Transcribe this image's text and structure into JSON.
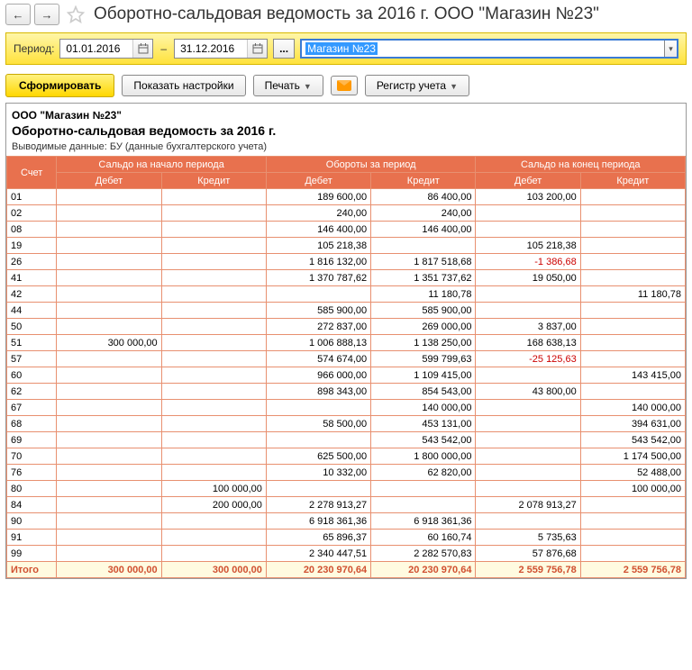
{
  "page_title": "Оборотно-сальдовая ведомость за 2016 г. ООО \"Магазин №23\"",
  "period": {
    "label": "Период:",
    "from": "01.01.2016",
    "to": "31.12.2016",
    "dash": "–",
    "dots": "..."
  },
  "org": {
    "value": "Магазин №23"
  },
  "buttons": {
    "form": "Сформировать",
    "show_settings": "Показать настройки",
    "print": "Печать",
    "register": "Регистр учета"
  },
  "report": {
    "company": "ООО \"Магазин №23\"",
    "title": "Оборотно-сальдовая ведомость за 2016 г.",
    "sub": "Выводимые данные:  БУ (данные бухгалтерского учета)",
    "hdr": {
      "account": "Счет",
      "open": "Сальдо на начало периода",
      "turnover": "Обороты за период",
      "close": "Сальдо на конец периода",
      "debit": "Дебет",
      "credit": "Кредит"
    },
    "rows": [
      {
        "acc": "01",
        "od": "",
        "oc": "",
        "td": "189 600,00",
        "tc": "86 400,00",
        "cd": "103 200,00",
        "cc": ""
      },
      {
        "acc": "02",
        "od": "",
        "oc": "",
        "td": "240,00",
        "tc": "240,00",
        "cd": "",
        "cc": ""
      },
      {
        "acc": "08",
        "od": "",
        "oc": "",
        "td": "146 400,00",
        "tc": "146 400,00",
        "cd": "",
        "cc": ""
      },
      {
        "acc": "19",
        "od": "",
        "oc": "",
        "td": "105 218,38",
        "tc": "",
        "cd": "105 218,38",
        "cc": ""
      },
      {
        "acc": "26",
        "od": "",
        "oc": "",
        "td": "1 816 132,00",
        "tc": "1 817 518,68",
        "cd": "-1 386,68",
        "cc": "",
        "neg_cd": true
      },
      {
        "acc": "41",
        "od": "",
        "oc": "",
        "td": "1 370 787,62",
        "tc": "1 351 737,62",
        "cd": "19 050,00",
        "cc": ""
      },
      {
        "acc": "42",
        "od": "",
        "oc": "",
        "td": "",
        "tc": "11 180,78",
        "cd": "",
        "cc": "11 180,78"
      },
      {
        "acc": "44",
        "od": "",
        "oc": "",
        "td": "585 900,00",
        "tc": "585 900,00",
        "cd": "",
        "cc": ""
      },
      {
        "acc": "50",
        "od": "",
        "oc": "",
        "td": "272 837,00",
        "tc": "269 000,00",
        "cd": "3 837,00",
        "cc": ""
      },
      {
        "acc": "51",
        "od": "300 000,00",
        "oc": "",
        "td": "1 006 888,13",
        "tc": "1 138 250,00",
        "cd": "168 638,13",
        "cc": ""
      },
      {
        "acc": "57",
        "od": "",
        "oc": "",
        "td": "574 674,00",
        "tc": "599 799,63",
        "cd": "-25 125,63",
        "cc": "",
        "neg_cd": true
      },
      {
        "acc": "60",
        "od": "",
        "oc": "",
        "td": "966 000,00",
        "tc": "1 109 415,00",
        "cd": "",
        "cc": "143 415,00"
      },
      {
        "acc": "62",
        "od": "",
        "oc": "",
        "td": "898 343,00",
        "tc": "854 543,00",
        "cd": "43 800,00",
        "cc": ""
      },
      {
        "acc": "67",
        "od": "",
        "oc": "",
        "td": "",
        "tc": "140 000,00",
        "cd": "",
        "cc": "140 000,00"
      },
      {
        "acc": "68",
        "od": "",
        "oc": "",
        "td": "58 500,00",
        "tc": "453 131,00",
        "cd": "",
        "cc": "394 631,00"
      },
      {
        "acc": "69",
        "od": "",
        "oc": "",
        "td": "",
        "tc": "543 542,00",
        "cd": "",
        "cc": "543 542,00"
      },
      {
        "acc": "70",
        "od": "",
        "oc": "",
        "td": "625 500,00",
        "tc": "1 800 000,00",
        "cd": "",
        "cc": "1 174 500,00"
      },
      {
        "acc": "76",
        "od": "",
        "oc": "",
        "td": "10 332,00",
        "tc": "62 820,00",
        "cd": "",
        "cc": "52 488,00"
      },
      {
        "acc": "80",
        "od": "",
        "oc": "100 000,00",
        "td": "",
        "tc": "",
        "cd": "",
        "cc": "100 000,00"
      },
      {
        "acc": "84",
        "od": "",
        "oc": "200 000,00",
        "td": "2 278 913,27",
        "tc": "",
        "cd": "2 078 913,27",
        "cc": ""
      },
      {
        "acc": "90",
        "od": "",
        "oc": "",
        "td": "6 918 361,36",
        "tc": "6 918 361,36",
        "cd": "",
        "cc": ""
      },
      {
        "acc": "91",
        "od": "",
        "oc": "",
        "td": "65 896,37",
        "tc": "60 160,74",
        "cd": "5 735,63",
        "cc": ""
      },
      {
        "acc": "99",
        "od": "",
        "oc": "",
        "td": "2 340 447,51",
        "tc": "2 282 570,83",
        "cd": "57 876,68",
        "cc": ""
      }
    ],
    "total": {
      "label": "Итого",
      "od": "300 000,00",
      "oc": "300 000,00",
      "td": "20 230 970,64",
      "tc": "20 230 970,64",
      "cd": "2 559 756,78",
      "cc": "2 559 756,78"
    }
  }
}
